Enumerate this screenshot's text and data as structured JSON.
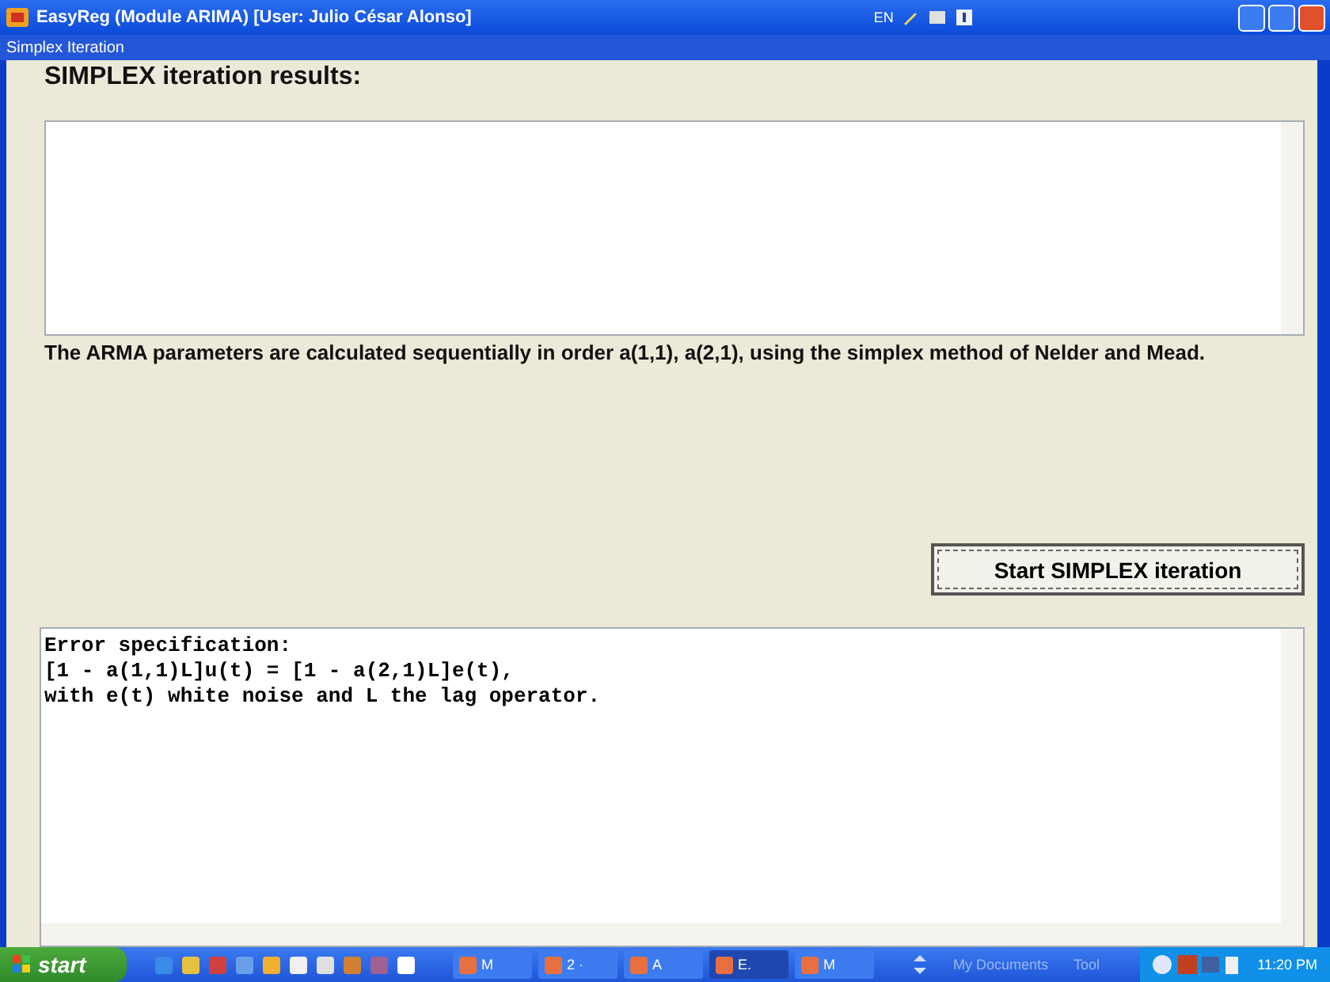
{
  "window": {
    "title": "EasyReg (Module ARIMA) [User: Julio César Alonso]",
    "language": "EN"
  },
  "dialog": {
    "title": "Simplex Iteration"
  },
  "results": {
    "heading": "SIMPLEX iteration results:"
  },
  "description": "The ARMA parameters are calculated sequentially in order a(1,1), a(2,1), using the simplex method of Nelder and Mead.",
  "start_button": {
    "label": "Start SIMPLEX iteration"
  },
  "specification": {
    "lines": [
      "Error specification:",
      "[1 - a(1,1)L]u(t) = [1 - a(2,1)L]e(t),",
      "with e(t) white noise and L the lag operator."
    ]
  },
  "taskbar": {
    "start": "start",
    "tasks": [
      {
        "label": "M",
        "selected": false
      },
      {
        "label": "2 ·",
        "selected": false
      },
      {
        "label": "A",
        "selected": false
      },
      {
        "label": "E.",
        "selected": true
      },
      {
        "label": "M",
        "selected": false
      }
    ],
    "toolbars": [
      "My Documents",
      "Tool"
    ],
    "clock": "11:20 PM"
  }
}
